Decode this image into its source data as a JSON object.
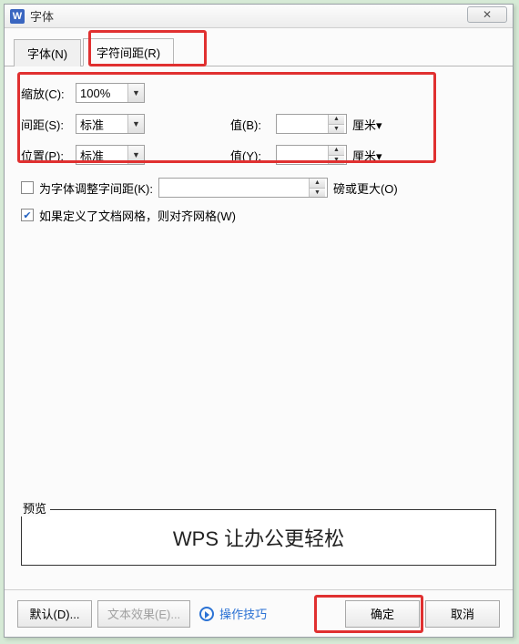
{
  "window": {
    "appInitial": "W",
    "title": "字体",
    "closeGlyph": "✕"
  },
  "tabs": {
    "font": "字体(N)",
    "spacing": "字符间距(R)"
  },
  "fields": {
    "scale": {
      "label": "缩放(C):",
      "value": "100%"
    },
    "spacing": {
      "label": "间距(S):",
      "value": "标准",
      "valueLabel": "值(B):",
      "valueInput": "",
      "unit": "厘米▾"
    },
    "position": {
      "label": "位置(P):",
      "value": "标准",
      "valueLabel": "值(Y):",
      "valueInput": "",
      "unit": "厘米▾"
    },
    "kerning": {
      "label": "为字体调整字间距(K):",
      "value": "",
      "unit": "磅或更大(O)"
    },
    "snapGrid": {
      "label": "如果定义了文档网格，则对齐网格(W)"
    }
  },
  "preview": {
    "label": "预览",
    "text": "WPS 让办公更轻松"
  },
  "footer": {
    "default": "默认(D)...",
    "textEffect": "文本效果(E)...",
    "help": "操作技巧",
    "ok": "确定",
    "cancel": "取消"
  },
  "glyph": {
    "caretDown": "▼",
    "up": "▲",
    "down": "▼"
  }
}
